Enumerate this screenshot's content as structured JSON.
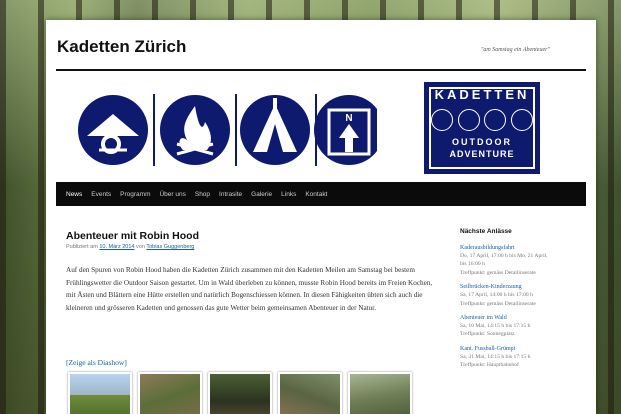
{
  "site": {
    "title": "Kadetten Zürich",
    "tagline": "\"am Samstag ein Abenteuer\""
  },
  "logo": {
    "line1": "KADETTEN",
    "line2": "OUTDOOR",
    "line3": "ADVENTURE"
  },
  "icons": [
    "rope-knot-icon",
    "campfire-icon",
    "tent-icon",
    "compass-north-icon"
  ],
  "nav": [
    "News",
    "Events",
    "Programm",
    "Über uns",
    "Shop",
    "Intrasite",
    "Galerie",
    "Links",
    "Kontakt"
  ],
  "post": {
    "title": "Abenteuer mit Robin Hood",
    "meta_prefix": "Publiziert am",
    "meta_date": "10. März 2014",
    "meta_by": "von",
    "meta_author": "Tobias Guggenberg",
    "body": "Auf den Spuren von Robin Hood haben die Kadetten Zürich zusammen mit den Kadetten Meilen am Samstag bei bestem Frühlingswetter die Outdoor Saison gestartet. Um in Wald überleben zu können, musste Robin Hood bereits im Freien Kochen, mit Ästen und Blättern eine Hütte erstellen und natürlich Bogenschiessen können. In diesen Fähigkeiten übten sich auch die kleineren und grösseren Kadetten und genossen das gute Wetter beim gemeinsamen Abenteuer in der Natur.",
    "slideshow": "[Zeige als Diashow]"
  },
  "sidebar": {
    "heading": "Nächste Anlässe",
    "events": [
      {
        "name": "Kaderausbildungsfahrt",
        "line1": "Do, 17 April, 17:00 h bis Mo, 21 April,",
        "line2": "bis 16:00 h",
        "line3": "Treffpunkt: gemäss Detailinserate"
      },
      {
        "name": "Seilbrücken-Kinderzaung",
        "line1": "Sa, 17 April, 14:00 h bis 17:00 h",
        "line2": "Treffpunkt: gemäss Detailinserate",
        "line3": ""
      },
      {
        "name": "Abenteuer im Wald",
        "line1": "Sa, 10 Mai, 14:15 h bis 17:15 h",
        "line2": "Treffpunkt: Sonnegplatz",
        "line3": ""
      },
      {
        "name": "Kant. Fussball-Grümpi",
        "line1": "Sa, 31 Mai, 14:15 h bis 17:15 h",
        "line2": "Treffpunkt: Hauptbahnhof",
        "line3": ""
      }
    ]
  },
  "colors": {
    "navy": "#0d1a6e",
    "nav_bg": "#0b0b0b",
    "link": "#1b5ea8"
  }
}
